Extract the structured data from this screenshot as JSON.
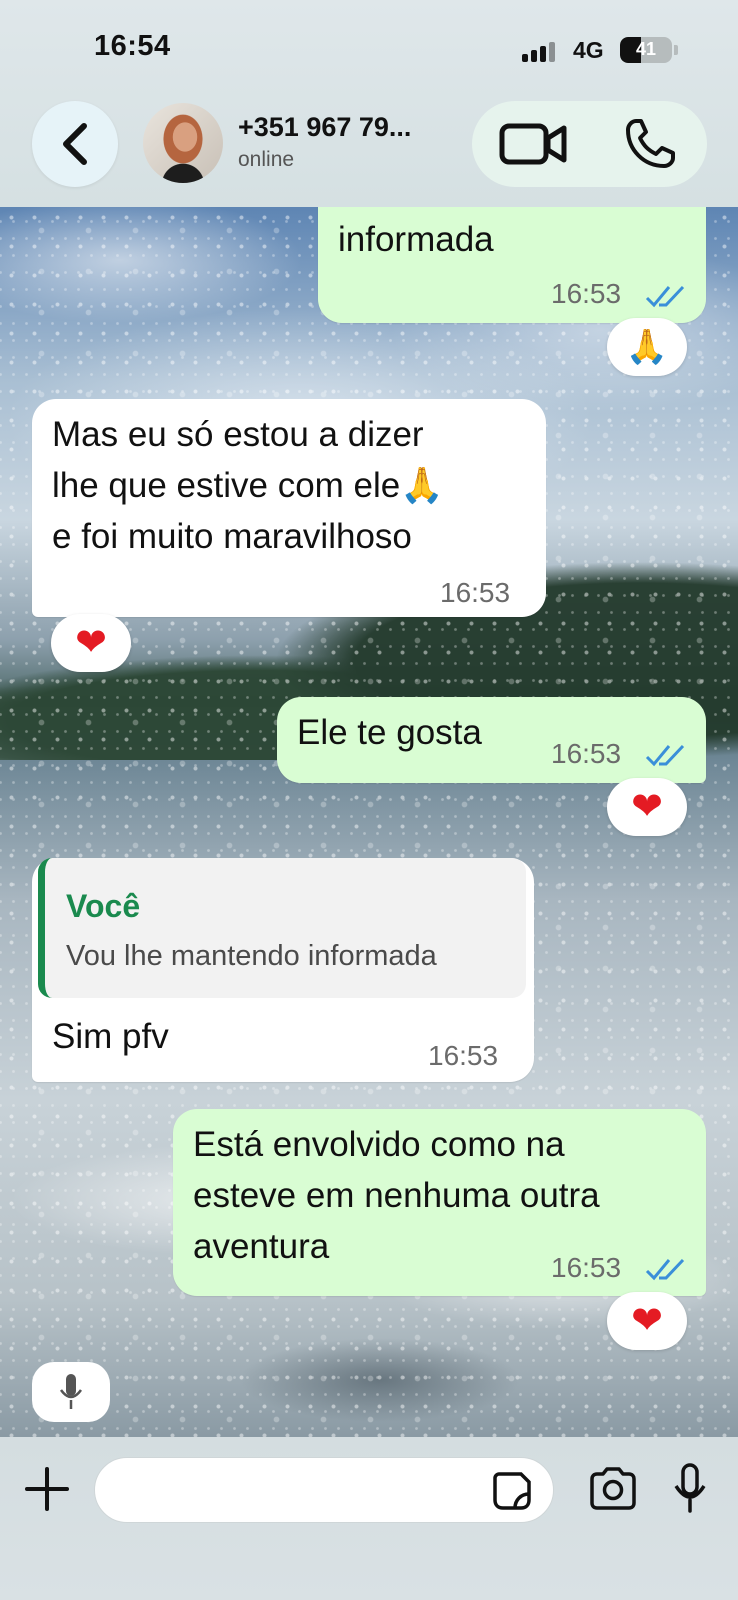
{
  "status_bar": {
    "time": "16:54",
    "network": "4G",
    "battery": "41",
    "battery_level": 0.41
  },
  "header": {
    "contact_name": "+351 967 79...",
    "contact_status": "online",
    "icons": [
      "back-icon",
      "video-call-icon",
      "phone-icon"
    ]
  },
  "messages": [
    {
      "direction": "outgoing",
      "text": "informada",
      "time": "16:53",
      "read": true,
      "reaction": "🙏"
    },
    {
      "direction": "incoming",
      "lines": [
        "Mas eu só estou a dizer",
        "lhe que estive com ele🙏",
        "e foi muito maravilhoso"
      ],
      "time": "16:53",
      "reaction": "❤"
    },
    {
      "direction": "outgoing",
      "text": "Ele te gosta",
      "time": "16:53",
      "read": true,
      "reaction": "❤"
    },
    {
      "direction": "incoming",
      "quote": {
        "author": "Você",
        "text": "Vou lhe mantendo informada"
      },
      "text": "Sim pfv",
      "time": "16:53"
    },
    {
      "direction": "outgoing",
      "lines": [
        "Está envolvido como na",
        "esteve em nenhuma outra",
        "aventura"
      ],
      "time": "16:53",
      "read": true,
      "reaction": "❤"
    }
  ],
  "composer": {
    "value": "",
    "placeholder": "",
    "icons": [
      "plus-icon",
      "sticker-icon",
      "camera-icon",
      "microphone-icon"
    ]
  },
  "colors": {
    "outgoing_bubble": "#d9fdd3",
    "incoming_bubble": "#ffffff",
    "read_ticks": "#3a8fd9",
    "quote_accent": "#1a8a4e"
  }
}
